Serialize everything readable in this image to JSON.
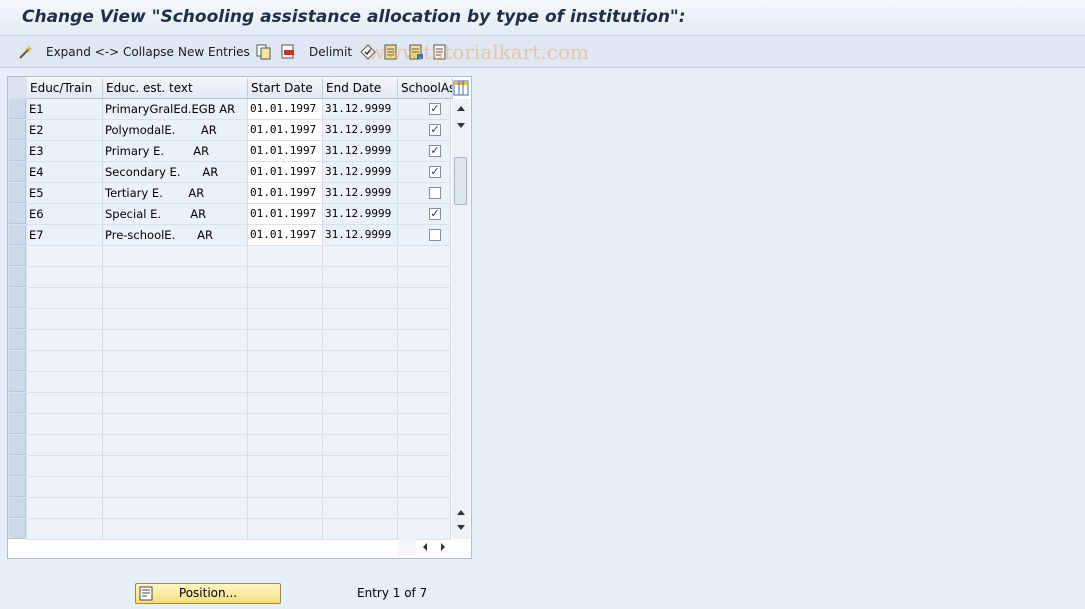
{
  "title": "Change View \"Schooling assistance allocation by type of institution\":",
  "toolbar": {
    "expand_collapse": "Expand <-> Collapse",
    "new_entries": "New Entries",
    "delimit": "Delimit"
  },
  "watermark": "www.tutorialkart.com",
  "table": {
    "headers": [
      "Educ/Train",
      "Educ. est. text",
      "Start Date",
      "End Date",
      "SchoolAss"
    ],
    "rows": [
      {
        "code": "E1",
        "text": "PrimaryGralEd.EGB AR",
        "start": "01.01.1997",
        "end": "31.12.9999",
        "checked": true
      },
      {
        "code": "E2",
        "text": "PolymodalE.       AR",
        "start": "01.01.1997",
        "end": "31.12.9999",
        "checked": true
      },
      {
        "code": "E3",
        "text": "Primary E.        AR",
        "start": "01.01.1997",
        "end": "31.12.9999",
        "checked": true
      },
      {
        "code": "E4",
        "text": "Secondary E.      AR",
        "start": "01.01.1997",
        "end": "31.12.9999",
        "checked": true
      },
      {
        "code": "E5",
        "text": "Tertiary E.       AR",
        "start": "01.01.1997",
        "end": "31.12.9999",
        "checked": false
      },
      {
        "code": "E6",
        "text": "Special E.        AR",
        "start": "01.01.1997",
        "end": "31.12.9999",
        "checked": true
      },
      {
        "code": "E7",
        "text": "Pre-schoolE.      AR",
        "start": "01.01.1997",
        "end": "31.12.9999",
        "checked": false
      }
    ]
  },
  "footer": {
    "position_button": "Position...",
    "entry_info": "Entry 1 of 7"
  },
  "icons": {
    "toolbar": [
      "wand-icon",
      "copy-icon",
      "delete-icon",
      "select-all-icon",
      "deselect-icon",
      "block-icon",
      "details-icon"
    ]
  }
}
